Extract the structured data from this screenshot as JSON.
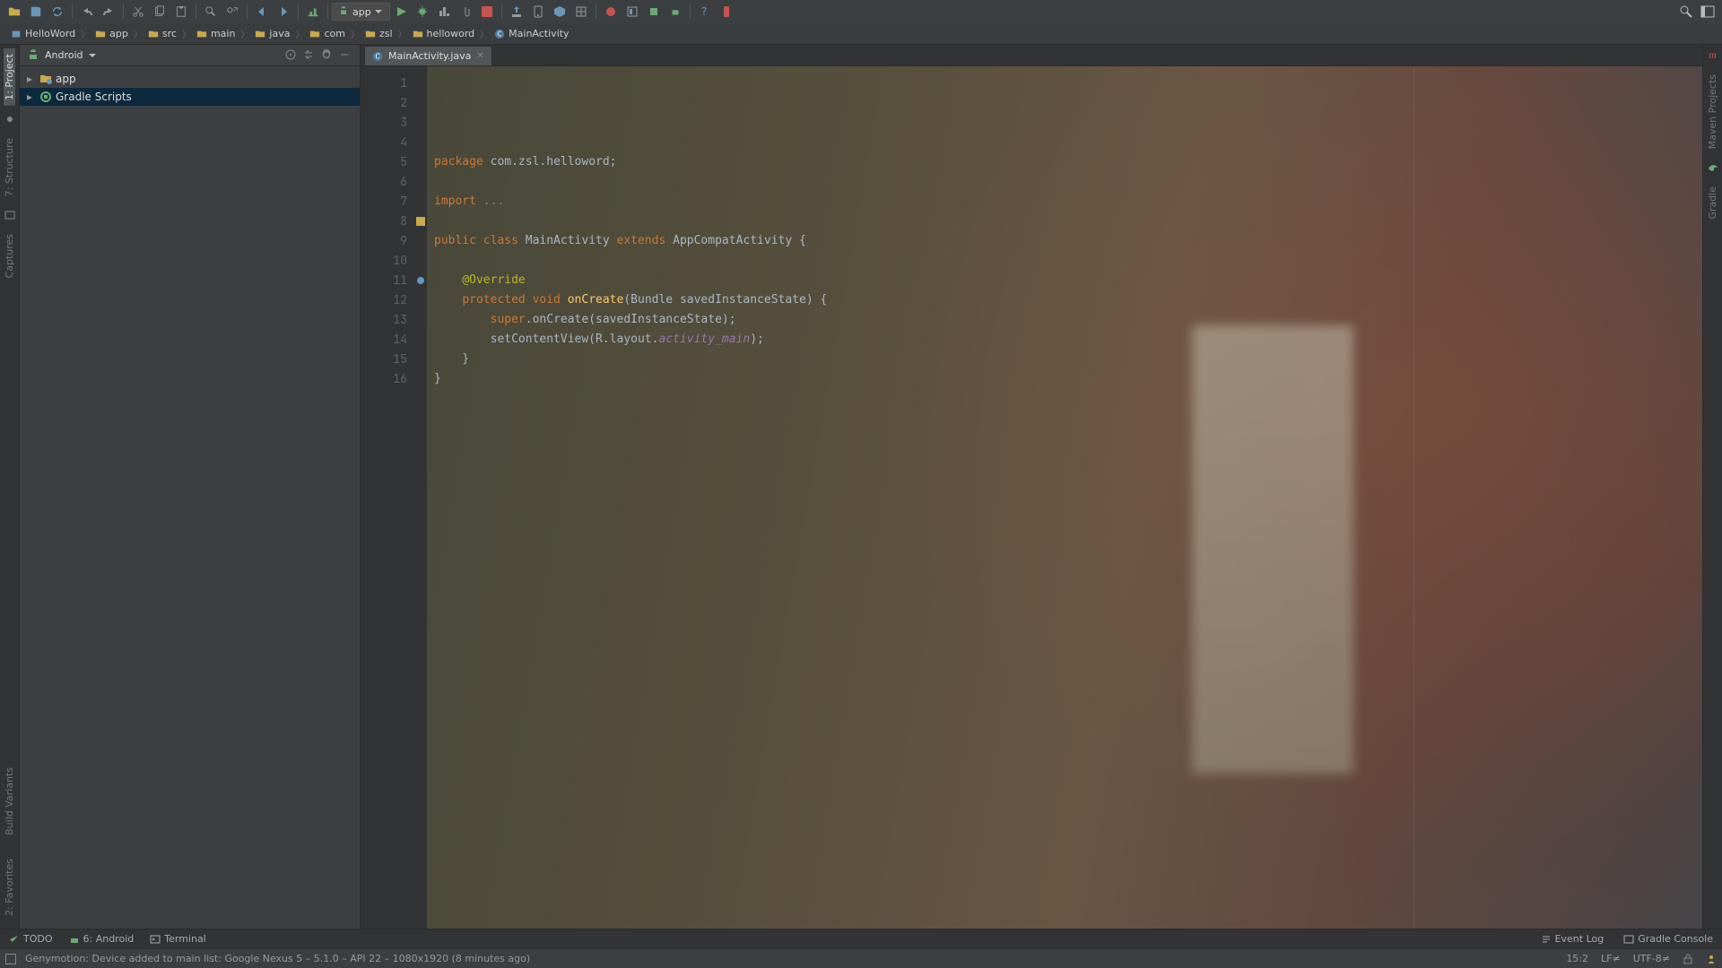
{
  "toolbar": {
    "run_config": "app"
  },
  "breadcrumbs": [
    "HelloWord",
    "app",
    "src",
    "main",
    "java",
    "com",
    "zsl",
    "helloword",
    "MainActivity"
  ],
  "project_panel": {
    "mode": "Android",
    "tree": [
      {
        "label": "app",
        "kind": "module",
        "depth": 0,
        "selected": false
      },
      {
        "label": "Gradle Scripts",
        "kind": "gradle",
        "depth": 0,
        "selected": true
      }
    ]
  },
  "editor_tab": {
    "filename": "MainActivity.java"
  },
  "vstrip_left": {
    "top": [
      "1: Project",
      "7: Structure"
    ],
    "bottom": [
      "Build Variants",
      "2: Favorites"
    ],
    "top_active_index": 0
  },
  "vstrip_right": {
    "top": [
      "Maven Projects"
    ],
    "bottom": [
      "Gradle"
    ],
    "icons": [
      "m"
    ]
  },
  "captures_label": "Captures",
  "code": {
    "line_start": 1,
    "line_end": 16,
    "lines": [
      [
        {
          "c": "kw",
          "t": "package"
        },
        {
          "t": " com.zsl.helloword;"
        }
      ],
      [],
      [
        {
          "c": "kw",
          "t": "import"
        },
        {
          "t": " "
        },
        {
          "c": "cmt",
          "t": "..."
        }
      ],
      [],
      [
        {
          "c": "kw",
          "t": "public class"
        },
        {
          "t": " MainActivity "
        },
        {
          "c": "kw",
          "t": "extends"
        },
        {
          "t": " AppCompatActivity {"
        }
      ],
      [],
      [
        {
          "t": "    "
        },
        {
          "c": "ann",
          "t": "@Override"
        }
      ],
      [
        {
          "t": "    "
        },
        {
          "c": "kw",
          "t": "protected void"
        },
        {
          "t": " "
        },
        {
          "c": "mth",
          "t": "onCreate"
        },
        {
          "t": "(Bundle savedInstanceState) {"
        }
      ],
      [
        {
          "t": "        "
        },
        {
          "c": "kw",
          "t": "super"
        },
        {
          "t": ".onCreate(savedInstanceState);"
        }
      ],
      [
        {
          "t": "        setContentView(R.layout."
        },
        {
          "c": "fld",
          "t": "activity_main"
        },
        {
          "t": ");"
        }
      ],
      [
        {
          "t": "    }"
        }
      ],
      [
        {
          "t": "}"
        }
      ],
      []
    ],
    "gutter_marks": {
      "8": "class",
      "11": "override"
    }
  },
  "bottom_tools": {
    "left": [
      "TODO",
      "6: Android",
      "Terminal"
    ],
    "right": [
      "Event Log",
      "Gradle Console"
    ]
  },
  "status": {
    "message": "Genymotion: Device added to main list: Google Nexus 5 – 5.1.0 – API 22 – 1080x1920 (8 minutes ago)",
    "pos": "15:2",
    "line_sep": "LF≠",
    "enc": "UTF-8≠"
  }
}
